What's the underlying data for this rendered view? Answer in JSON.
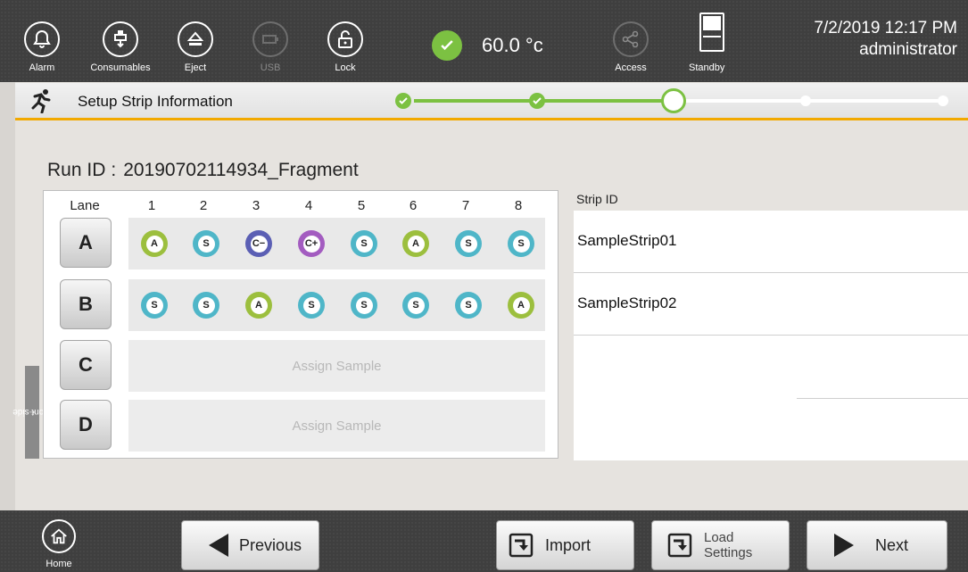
{
  "topbar": {
    "alarm_label": "Alarm",
    "consumables_label": "Consumables",
    "eject_label": "Eject",
    "usb_label": "USB",
    "lock_label": "Lock",
    "temperature": "60.0 °c",
    "access_label": "Access",
    "standby_label": "Standby",
    "date_time": "7/2/2019 12:17 PM",
    "user": "administrator",
    "colors": {
      "ok_green": "#7cc142",
      "accent": "#f2a900"
    }
  },
  "stepbar": {
    "title": "Setup Strip Information",
    "steps_completed": 2,
    "current_step": 3,
    "total_steps": 5
  },
  "run": {
    "label": "Run ID",
    "separator": ":",
    "value": "20190702114934_Fragment"
  },
  "grid": {
    "lane_header": "Lane",
    "columns": [
      "1",
      "2",
      "3",
      "4",
      "5",
      "6",
      "7",
      "8"
    ],
    "lanes": [
      {
        "label": "A",
        "wells": [
          "A",
          "S",
          "C−",
          "C+",
          "S",
          "A",
          "S",
          "S"
        ],
        "well_types": [
          "A",
          "S",
          "Cm",
          "Cp",
          "S",
          "A",
          "S",
          "S"
        ]
      },
      {
        "label": "B",
        "wells": [
          "S",
          "S",
          "A",
          "S",
          "S",
          "S",
          "S",
          "A"
        ],
        "well_types": [
          "S",
          "S",
          "A",
          "S",
          "S",
          "S",
          "S",
          "A"
        ]
      },
      {
        "label": "C",
        "assign_text": "Assign Sample"
      },
      {
        "label": "D",
        "assign_text": "Assign Sample"
      }
    ],
    "front_side_label": "Front side",
    "well_colors": {
      "S": "#4fb6c8",
      "A": "#9cbf3e",
      "C−": "#5b5fb4",
      "C+": "#a35cc0"
    }
  },
  "strips": {
    "header": "Strip ID",
    "rows": [
      "SampleStrip01",
      "SampleStrip02",
      "",
      ""
    ]
  },
  "bottombar": {
    "home_label": "Home",
    "previous_label": "Previous",
    "import_label": "Import",
    "load_settings_line1": "Load",
    "load_settings_line2": "Settings",
    "next_label": "Next"
  }
}
